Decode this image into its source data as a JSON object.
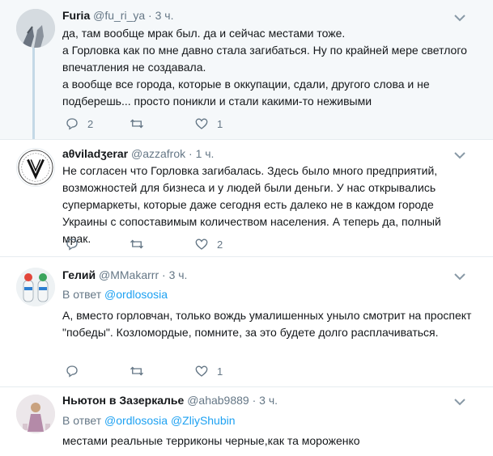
{
  "tweets": [
    {
      "name": "Furia",
      "handle": "@fu_ri_ya",
      "time": "3 ч.",
      "lines": [
        "да, там вообще мрак был. да и сейчас местами тоже.",
        "а Горловка как по мне давно стала загибаться. Ну по крайней мере светлого впечатления не создавала.",
        "а вообще все города, которые в оккупации, сдали, другого слова и не подберешь... просто поникли и стали какими-то неживыми"
      ],
      "reply_count": "2",
      "retweet_count": "",
      "like_count": "1"
    },
    {
      "name": "aθviladʒerar",
      "handle": "@azzafrok",
      "time": "1 ч.",
      "lines": [
        "Не согласен что Горловка загибалась. Здесь было много предприятий, возможностей для бизнеса и у людей были деньги. У нас открывались супермаркеты, которые даже сегодня есть далеко не в каждом городе Украины с сопоставимым количеством населения. А теперь да, полный мрак."
      ],
      "reply_count": "",
      "retweet_count": "",
      "like_count": "2"
    },
    {
      "name": "Гелий",
      "handle": "@MMakarrr",
      "time": "3 ч.",
      "reply_prefix": "В ответ",
      "reply_mentions": [
        "@ordlososia"
      ],
      "lines": [
        "А, вместо горловчан, только вождь умалишенных уныло смотрит на проспект \"победы\". Козломордые, помните, за это будете долго расплачиваться."
      ],
      "reply_count": "",
      "retweet_count": "",
      "like_count": "1"
    },
    {
      "name": "Ньютон в Зазеркалье",
      "handle": "@ahab9889",
      "time": "3 ч.",
      "reply_prefix": "В ответ",
      "reply_mentions": [
        "@ordlososia",
        "@ZliyShubin"
      ],
      "lines": [
        "местами реальные терриконы черные,как та мороженко"
      ]
    }
  ],
  "colors": {
    "text": "#14171a",
    "secondary": "#657786",
    "link": "#1da1f2",
    "highlight_bg": "#f5f8fa",
    "divider": "#e6ecf0",
    "thread_line": "#c4d8e6"
  },
  "icons": [
    "reply-icon",
    "retweet-icon",
    "like-icon",
    "chevron-down-icon"
  ]
}
